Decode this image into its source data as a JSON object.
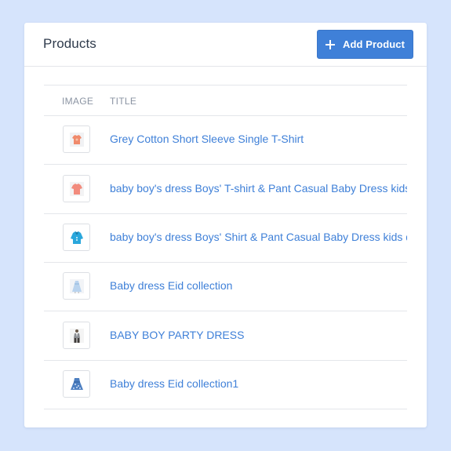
{
  "header": {
    "title": "Products",
    "add_button_label": "Add Product",
    "add_button_icon": "plus-icon"
  },
  "table": {
    "columns": [
      "IMAGE",
      "TITLE"
    ],
    "rows": [
      {
        "title": "Grey Cotton Short Sleeve Single T-Shirt",
        "thumb": "orange-tshirt-icon"
      },
      {
        "title": "baby boy's dress Boys' T-shirt & Pant Casual Baby Dress kids c",
        "thumb": "pink-tshirt-icon"
      },
      {
        "title": "baby boy's dress Boys' Shirt & Pant Casual Baby Dress kids dr",
        "thumb": "blue-shirt-icon"
      },
      {
        "title": "Baby dress Eid collection",
        "thumb": "light-blue-dress-icon"
      },
      {
        "title": "BABY BOY PARTY DRESS",
        "thumb": "boy-party-outfit-icon"
      },
      {
        "title": "Baby dress Eid collection1",
        "thumb": "blue-floral-dress-icon"
      }
    ]
  },
  "colors": {
    "page_background": "#d6e4fc",
    "accent": "#3f80d8",
    "link": "#3f80d8",
    "header_text": "#8b94a3"
  }
}
